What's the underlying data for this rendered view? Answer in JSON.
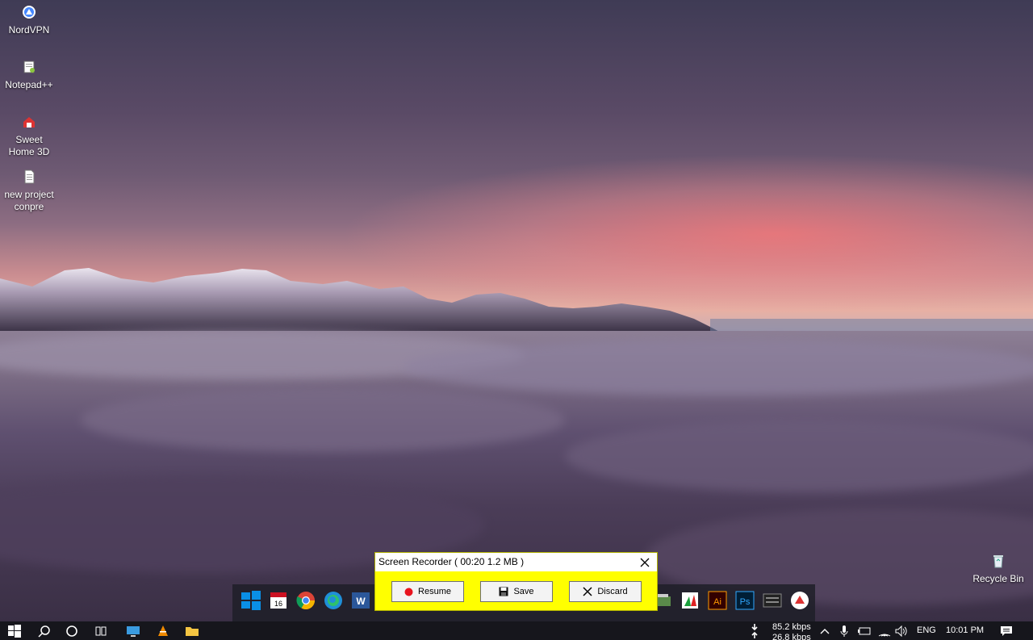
{
  "desktop_icons": [
    {
      "label": "NordVPN",
      "icon": "nordvpn-icon"
    },
    {
      "label": "Notepad++",
      "icon": "notepad-plus-plus-icon"
    },
    {
      "label": "Sweet Home 3D",
      "icon": "sweet-home-3d-icon"
    },
    {
      "label": "new project conpre",
      "icon": "document-icon"
    },
    {
      "label": "Recycle Bin",
      "icon": "recycle-bin-icon"
    }
  ],
  "recorder": {
    "title": "Screen Recorder ( 00:20   1.2 MB )",
    "resume_label": "Resume",
    "save_label": "Save",
    "discard_label": "Discard",
    "accent": "#ffff00",
    "record_dot_color": "#e8141e"
  },
  "dock_icons": [
    "windows-logo-icon",
    "calendar-icon",
    "chrome-icon",
    "edge-icon",
    "word-icon",
    "app-icon",
    "paint-icon",
    "illustrator-icon",
    "photoshop-icon",
    "keyboard-app-icon",
    "nordvpn-icon"
  ],
  "dock": {
    "calendar_day": "16",
    "illustrator": "Ai",
    "photoshop": "Ps",
    "word": "W"
  },
  "taskbar": {
    "icons": [
      "start-icon",
      "search-icon",
      "cortana-icon",
      "task-view-icon",
      "desktop-app-icon",
      "vlc-icon",
      "file-explorer-icon"
    ],
    "net_down": "85.2 kbps",
    "net_up": "26.8 kbps",
    "language": "ENG",
    "time": "10:01 PM"
  }
}
